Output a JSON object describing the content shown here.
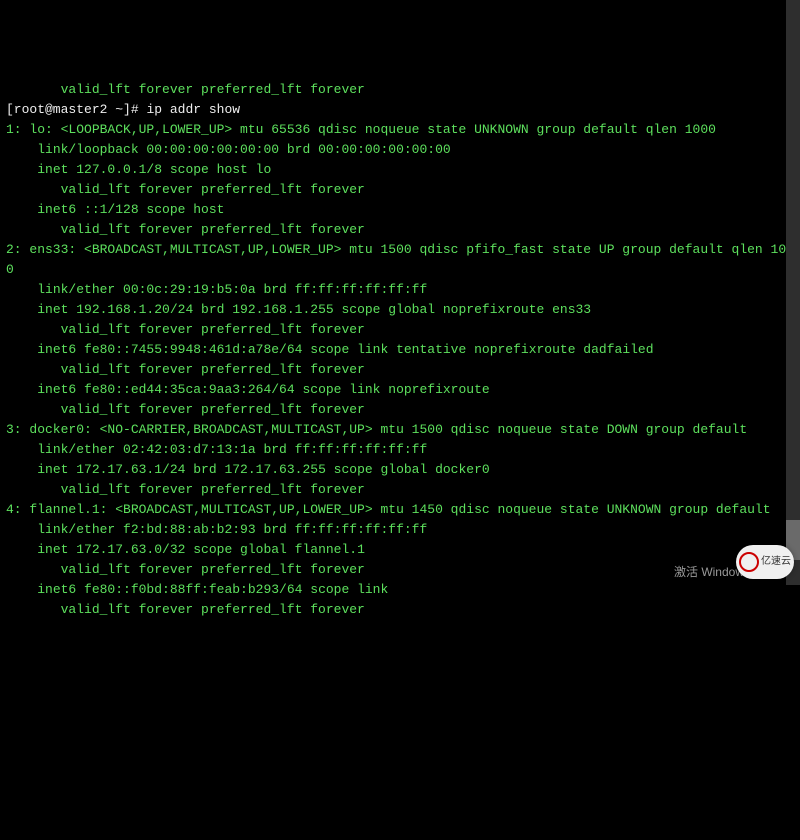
{
  "prev_fragment": "       valid_lft forever preferred_lft forever",
  "prompt": "[root@master2 ~]# ",
  "command": "ip addr show",
  "iface1_hdr": "1: lo: <LOOPBACK,UP,LOWER_UP> mtu 65536 qdisc noqueue state UNKNOWN group default qlen 1000",
  "iface1_lines": [
    "    link/loopback 00:00:00:00:00:00 brd 00:00:00:00:00:00",
    "    inet 127.0.0.1/8 scope host lo",
    "       valid_lft forever preferred_lft forever",
    "    inet6 ::1/128 scope host ",
    "       valid_lft forever preferred_lft forever"
  ],
  "iface2_hdr": "2: ens33: <BROADCAST,MULTICAST,UP,LOWER_UP> mtu 1500 qdisc pfifo_fast state UP group default qlen 1000",
  "iface2_lines": [
    "    link/ether 00:0c:29:19:b5:0a brd ff:ff:ff:ff:ff:ff",
    "    inet 192.168.1.20/24 brd 192.168.1.255 scope global noprefixroute ens33",
    "       valid_lft forever preferred_lft forever",
    "    inet6 fe80::7455:9948:461d:a78e/64 scope link tentative noprefixroute dadfailed ",
    "       valid_lft forever preferred_lft forever",
    "    inet6 fe80::ed44:35ca:9aa3:264/64 scope link noprefixroute ",
    "       valid_lft forever preferred_lft forever"
  ],
  "iface3_hdr": "3: docker0: <NO-CARRIER,BROADCAST,MULTICAST,UP> mtu 1500 qdisc noqueue state DOWN group default ",
  "iface3_lines": [
    "    link/ether 02:42:03:d7:13:1a brd ff:ff:ff:ff:ff:ff",
    "    inet 172.17.63.1/24 brd 172.17.63.255 scope global docker0",
    "       valid_lft forever preferred_lft forever"
  ],
  "iface4_hdr": "4: flannel.1: <BROADCAST,MULTICAST,UP,LOWER_UP> mtu 1450 qdisc noqueue state UNKNOWN group default ",
  "iface4_lines": [
    "    link/ether f2:bd:88:ab:b2:93 brd ff:ff:ff:ff:ff:ff",
    "    inet 172.17.63.0/32 scope global flannel.1",
    "       valid_lft forever preferred_lft forever",
    "    inet6 fe80::f0bd:88ff:feab:b293/64 scope link ",
    "       valid_lft forever preferred_lft forever"
  ],
  "watermark": "激活 Windows",
  "logo_text": "亿速云"
}
